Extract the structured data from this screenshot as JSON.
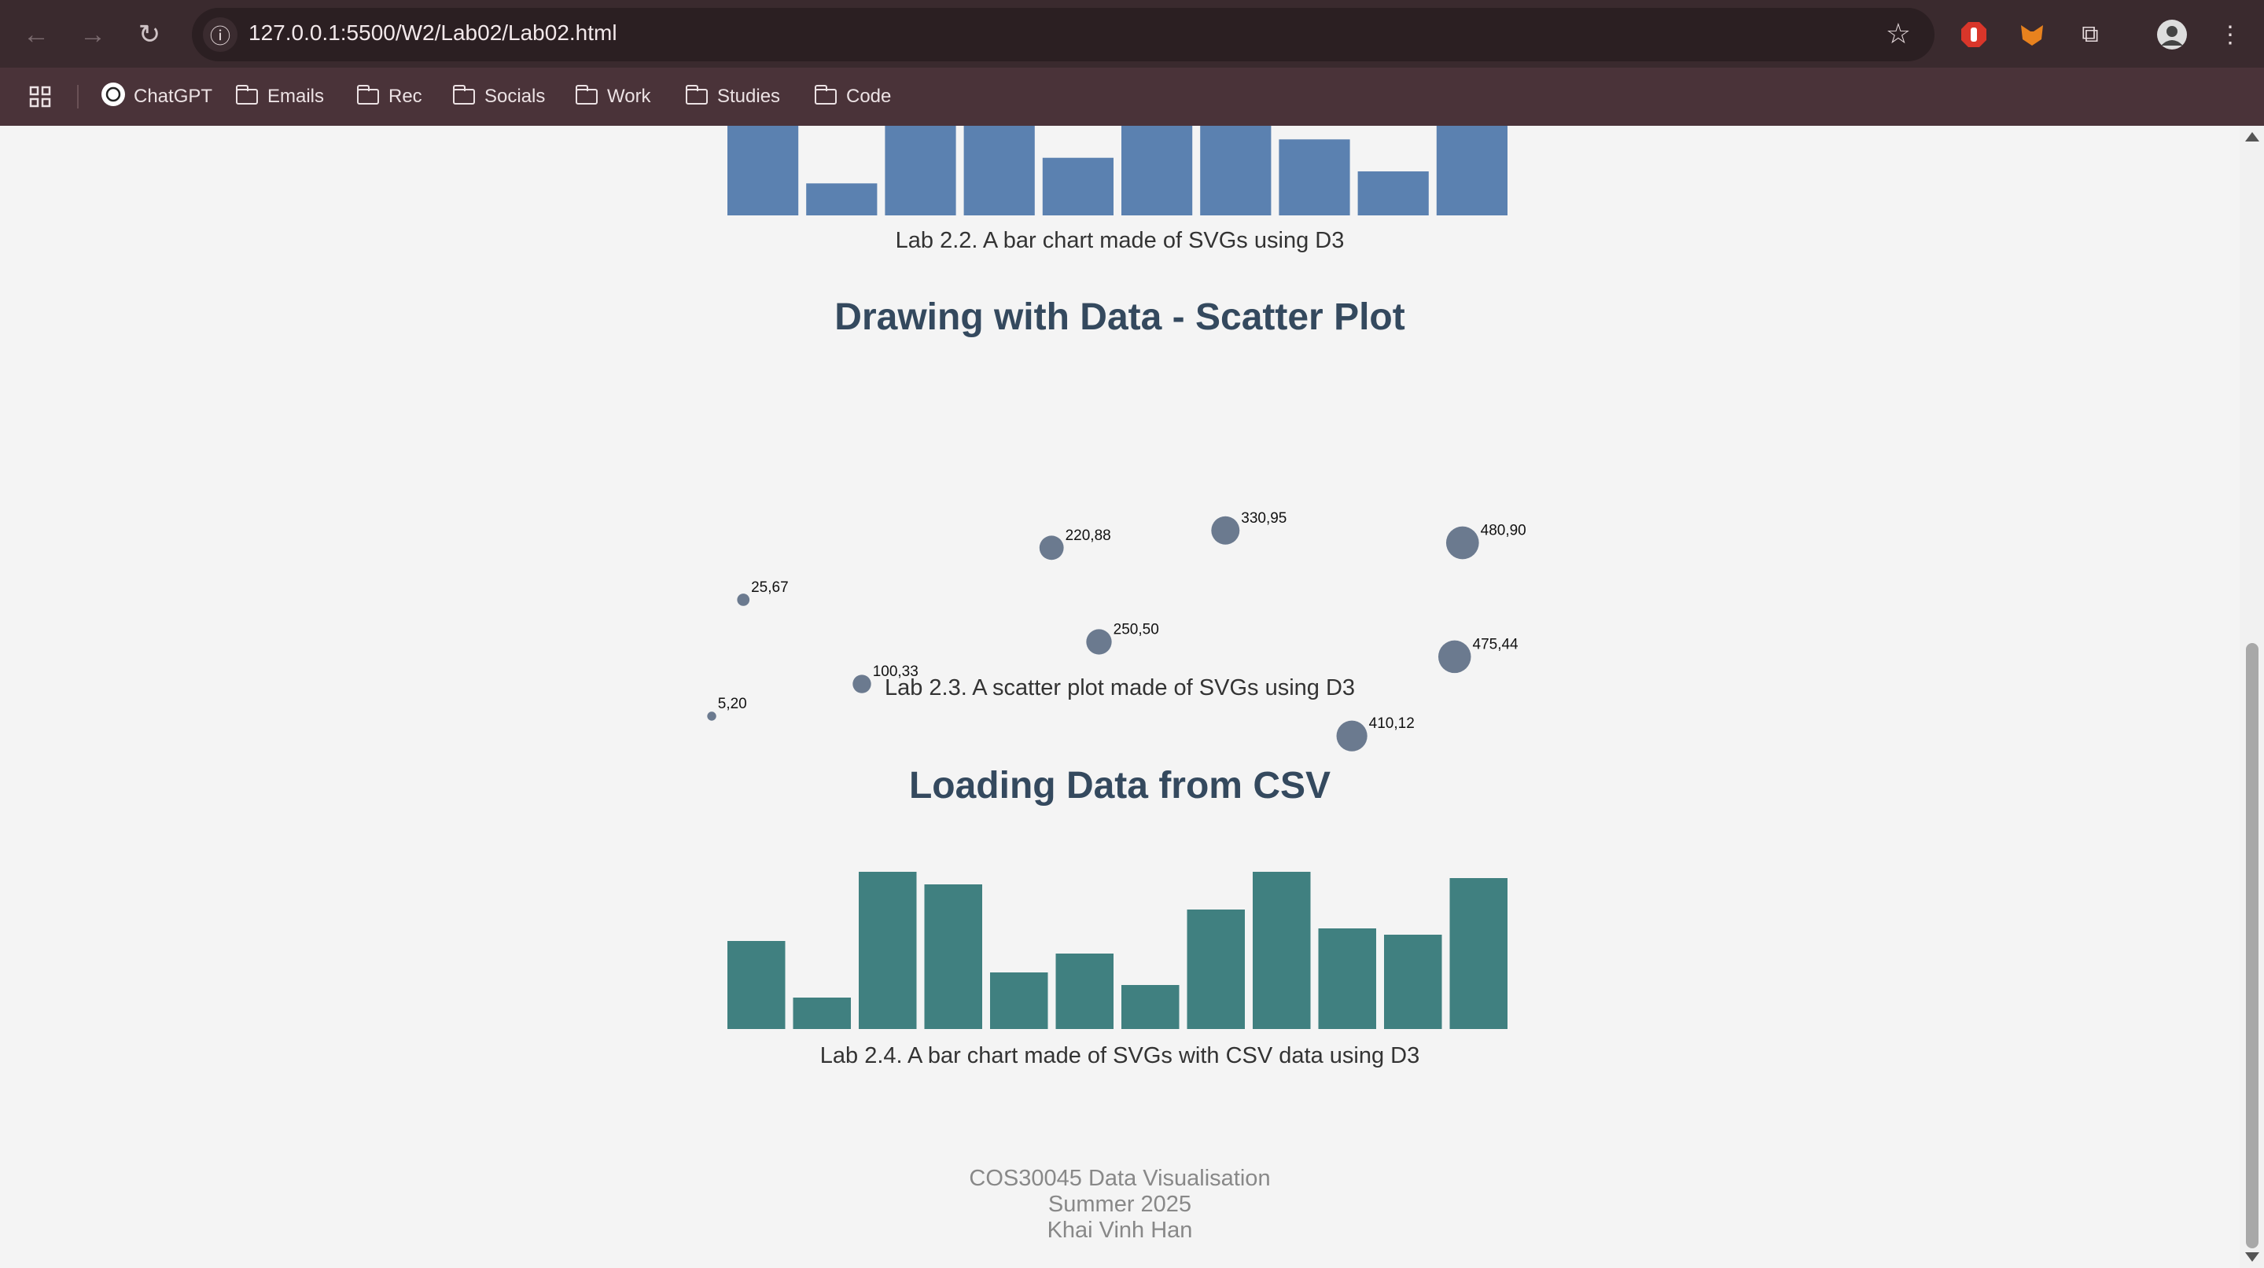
{
  "browser": {
    "url": "127.0.0.1:5500/W2/Lab02/Lab02.html",
    "bookmarks": [
      "ChatGPT",
      "Emails",
      "Rec",
      "Socials",
      "Work",
      "Studies",
      "Code"
    ]
  },
  "sections": {
    "caption_22": "Lab 2.2. A bar chart made of SVGs using D3",
    "heading_scatter": "Drawing with Data - Scatter Plot",
    "caption_23": "Lab 2.3. A scatter plot made of SVGs using D3",
    "heading_csv": "Loading Data from CSV",
    "caption_24": "Lab 2.4. A bar chart made of SVGs with CSV data using D3"
  },
  "footer": {
    "course": "COS30045 Data Visualisation",
    "term": "Summer 2025",
    "author": "Khai Vinh Han"
  },
  "chart_data": [
    {
      "type": "bar",
      "color": "#5b81b0",
      "values": [
        112,
        40,
        112,
        112,
        72,
        112,
        112,
        95,
        55,
        112
      ],
      "note": "partially scrolled out of view (tops clipped)"
    },
    {
      "type": "scatter",
      "color": "#6b7a8f",
      "x": [
        5,
        25,
        100,
        220,
        250,
        330,
        410,
        475,
        480
      ],
      "y": [
        20,
        67,
        33,
        88,
        50,
        95,
        12,
        44,
        90
      ],
      "labels": [
        "5,20",
        "25,67",
        "100,33",
        "220,88",
        "250,50",
        "330,95",
        "410,12",
        "475,44",
        "480,90"
      ]
    },
    {
      "type": "bar",
      "color": "#408080",
      "values": [
        14,
        5,
        25,
        23,
        9,
        12,
        7,
        19,
        25,
        16,
        15,
        24
      ]
    }
  ]
}
